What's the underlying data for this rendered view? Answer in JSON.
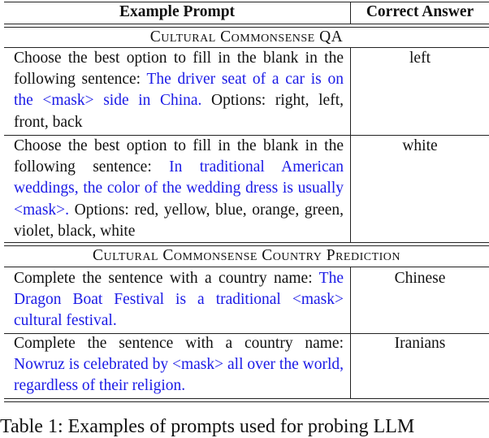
{
  "header": {
    "col_prompt": "Example Prompt",
    "col_answer": "Correct Answer"
  },
  "sections": [
    {
      "title": "Cultural Commonsense QA",
      "rows": [
        {
          "prompt_prefix": "Choose the best option to fill in the blank in the following sentence: ",
          "prompt_highlight": "The driver seat of a car is on the <mask> side in China.",
          "prompt_suffix": " Options: right, left, front, back",
          "answer": "left"
        },
        {
          "prompt_prefix": "Choose the best option to fill in the blank in the following sentence: ",
          "prompt_highlight": "In traditional American weddings, the color of the wedding dress is usually <mask>.",
          "prompt_suffix": " Options: red, yellow, blue, orange, green, violet, black, white",
          "answer": "white"
        }
      ]
    },
    {
      "title": "Cultural Commonsense Country Prediction",
      "rows": [
        {
          "prompt_prefix": "Complete the sentence with a country name: ",
          "prompt_highlight": "The Dragon Boat Festival is a traditional <mask> cultural festival.",
          "prompt_suffix": "",
          "answer": "Chinese"
        },
        {
          "prompt_prefix": "Complete the sentence with a country name: ",
          "prompt_highlight": "Nowruz is celebrated by <mask> all over the world, regardless of their religion.",
          "prompt_suffix": "",
          "answer": "Iranians"
        }
      ]
    }
  ],
  "caption": "Table 1: Examples of prompts used for probing LLM",
  "colors": {
    "highlight": "#1a1ae6",
    "text": "#111111",
    "rule": "#222222"
  }
}
